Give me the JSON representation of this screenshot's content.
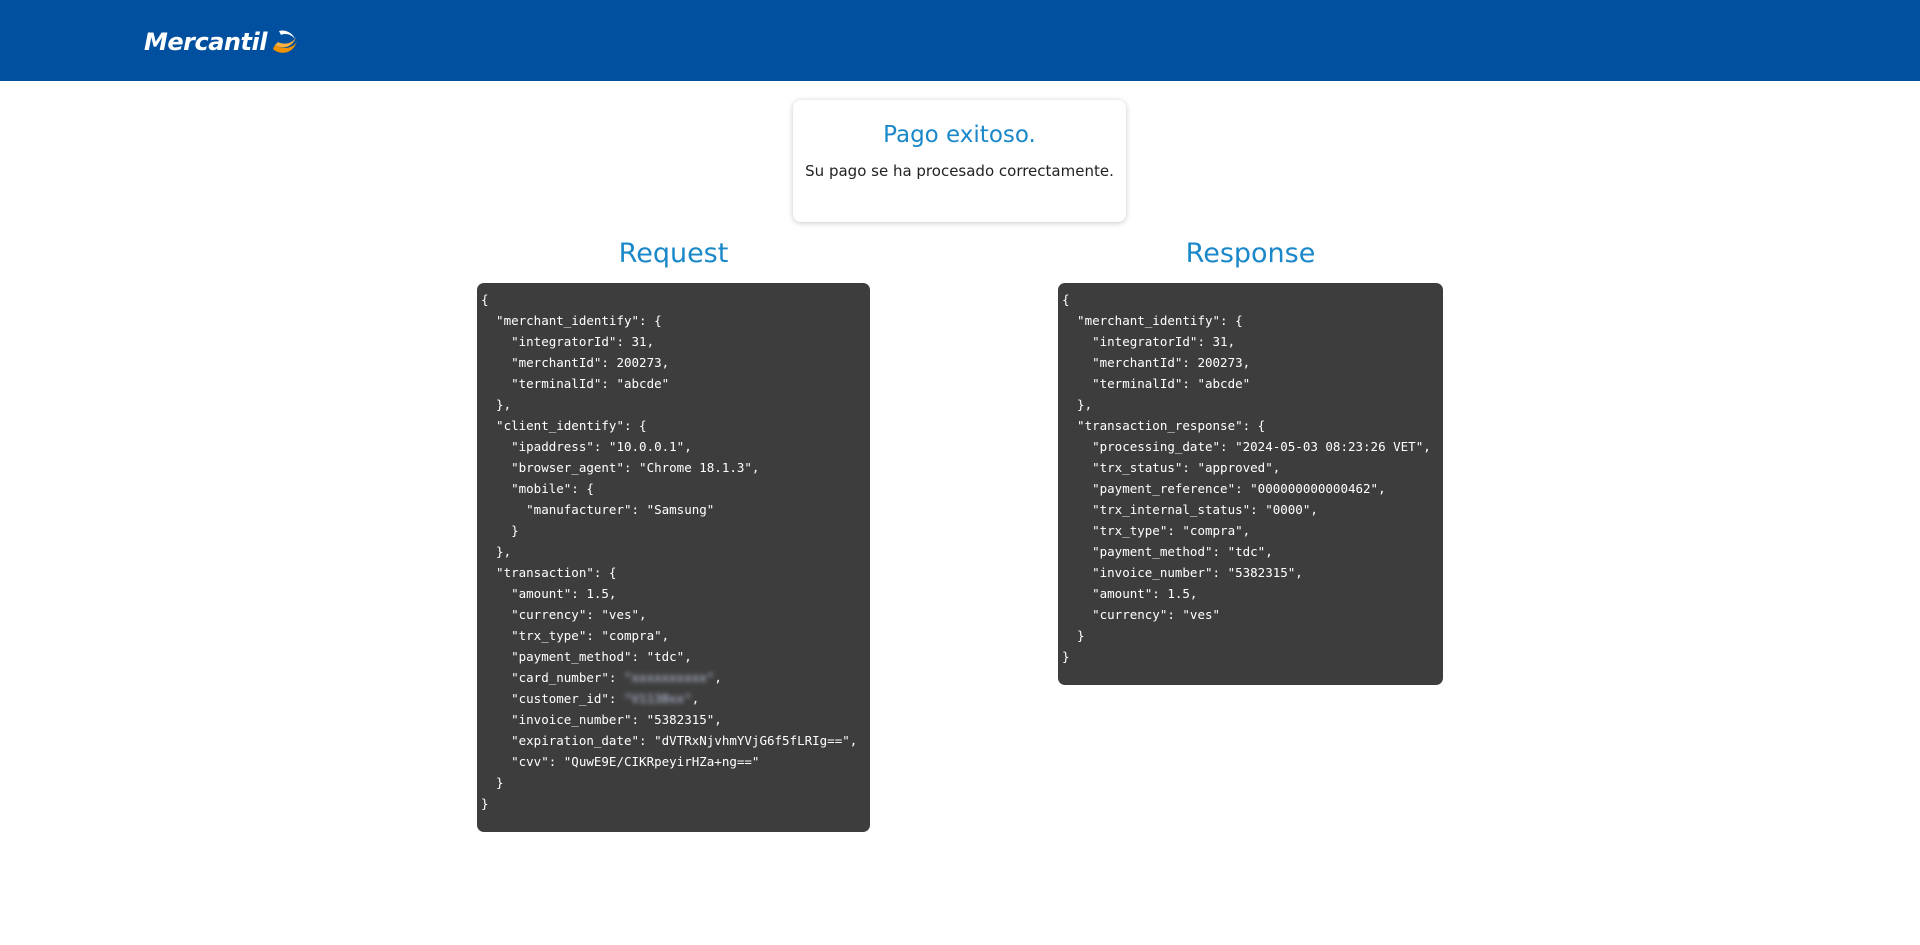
{
  "header": {
    "brand": "Mercantil",
    "brand_color": "#00509f",
    "logo_icon": "mercantil-swoosh-icon"
  },
  "status": {
    "title": "Pago exitoso.",
    "message": "Su pago se ha procesado correctamente."
  },
  "request": {
    "title": "Request",
    "lines": [
      "{",
      "  \"merchant_identify\": {",
      "    \"integratorId\": 31,",
      "    \"merchantId\": 200273,",
      "    \"terminalId\": \"abcde\"",
      "  },",
      "  \"client_identify\": {",
      "    \"ipaddress\": \"10.0.0.1\",",
      "    \"browser_agent\": \"Chrome 18.1.3\",",
      "    \"mobile\": {",
      "      \"manufacturer\": \"Samsung\"",
      "    }",
      "  },",
      "  \"transaction\": {",
      "    \"amount\": 1.5,",
      "    \"currency\": \"ves\",",
      "    \"trx_type\": \"compra\",",
      "    \"payment_method\": \"tdc\",",
      "    \"card_number\": ",
      "    \"customer_id\": ",
      "    \"invoice_number\": \"5382315\",",
      "    \"expiration_date\": \"dVTRxNjvhmYVjG6f5fLRIg==\",",
      "    \"cvv\": \"QuwE9E/CIKRpeyirHZa+ng==\"",
      "  }",
      "}"
    ],
    "card_number_value": "\"xxxxxxxxxx\"",
    "customer_id_value": "\"V1138xx\"",
    "line_suffix": ","
  },
  "response": {
    "title": "Response",
    "lines": [
      "{",
      "  \"merchant_identify\": {",
      "    \"integratorId\": 31,",
      "    \"merchantId\": 200273,",
      "    \"terminalId\": \"abcde\"",
      "  },",
      "  \"transaction_response\": {",
      "    \"processing_date\": \"2024-05-03 08:23:26 VET\",",
      "    \"trx_status\": \"approved\",",
      "    \"payment_reference\": \"000000000000462\",",
      "    \"trx_internal_status\": \"0000\",",
      "    \"trx_type\": \"compra\",",
      "    \"payment_method\": \"tdc\",",
      "    \"invoice_number\": \"5382315\",",
      "    \"amount\": 1.5,",
      "    \"currency\": \"ves\"",
      "  }",
      "}"
    ]
  }
}
